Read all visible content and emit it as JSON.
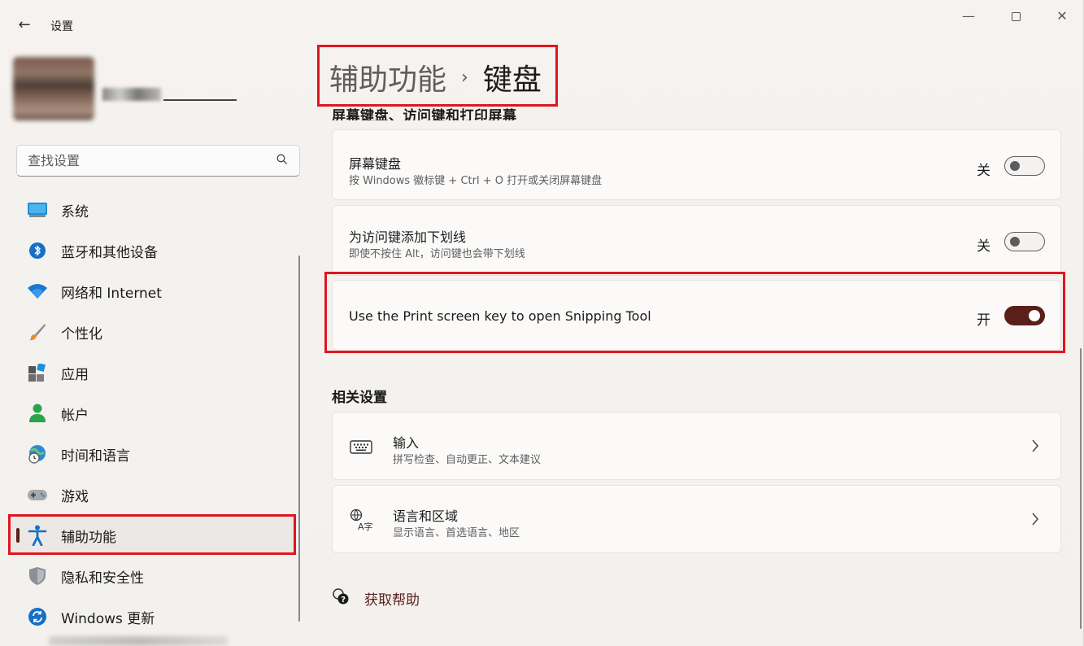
{
  "window": {
    "title": "设置",
    "controls": {
      "minimize": "—",
      "maximize": "□",
      "close": "✕"
    }
  },
  "search": {
    "placeholder": "查找设置"
  },
  "sidebar": {
    "items": [
      {
        "label": "系统",
        "icon": "system-icon"
      },
      {
        "label": "蓝牙和其他设备",
        "icon": "bluetooth-icon"
      },
      {
        "label": "网络和 Internet",
        "icon": "wifi-icon"
      },
      {
        "label": "个性化",
        "icon": "brush-icon"
      },
      {
        "label": "应用",
        "icon": "apps-icon"
      },
      {
        "label": "帐户",
        "icon": "account-icon"
      },
      {
        "label": "时间和语言",
        "icon": "globe-clock-icon"
      },
      {
        "label": "游戏",
        "icon": "gamepad-icon"
      },
      {
        "label": "辅助功能",
        "icon": "accessibility-icon",
        "active": true
      },
      {
        "label": "隐私和安全性",
        "icon": "shield-icon"
      },
      {
        "label": "Windows 更新",
        "icon": "update-icon"
      }
    ]
  },
  "breadcrumb": {
    "parent": "辅助功能",
    "separator": "›",
    "current": "键盘"
  },
  "section_partial": "屏幕键盘、访问键和打印屏幕",
  "settings": [
    {
      "title": "屏幕键盘",
      "subtitle": "按 Windows 徽标键 + Ctrl + O 打开或关闭屏幕键盘",
      "state": "关",
      "on": false
    },
    {
      "title": "为访问键添加下划线",
      "subtitle": "即使不按住 Alt，访问键也会带下划线",
      "state": "关",
      "on": false
    },
    {
      "title": "Use the Print screen key to open Snipping Tool",
      "state": "开",
      "on": true
    }
  ],
  "related": {
    "heading": "相关设置",
    "items": [
      {
        "title": "输入",
        "subtitle": "拼写检查、自动更正、文本建议",
        "icon": "keyboard-icon"
      },
      {
        "title": "语言和区域",
        "subtitle": "显示语言、首选语言、地区",
        "icon": "language-icon"
      }
    ]
  },
  "help": {
    "label": "获取帮助",
    "icon": "help-icon"
  },
  "colors": {
    "accent": "#5a1f18",
    "highlight": "#e0161e"
  }
}
